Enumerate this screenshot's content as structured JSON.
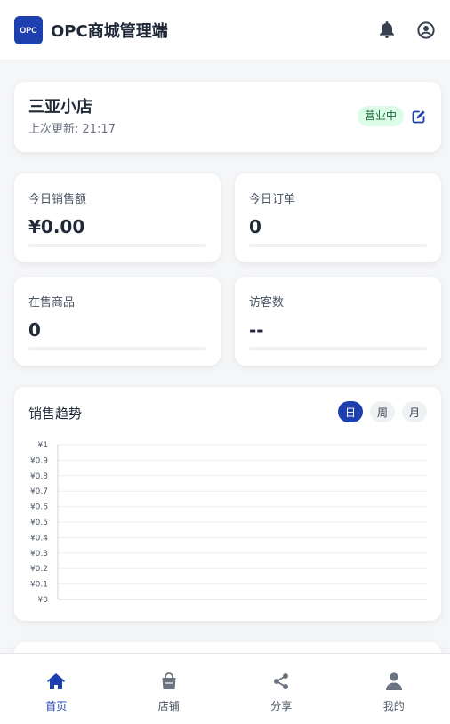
{
  "header": {
    "logo_text": "OPC",
    "title": "OPC商城管理端",
    "icons": [
      "bell-icon",
      "user-circle-icon"
    ]
  },
  "store": {
    "name": "三亚小店",
    "updated": "上次更新: 21:17",
    "status": "营业中",
    "status_color": "#dcfce7"
  },
  "stats": [
    {
      "label": "今日销售额",
      "value": "¥0.00"
    },
    {
      "label": "今日订单",
      "value": "0"
    },
    {
      "label": "在售商品",
      "value": "0"
    },
    {
      "label": "访客数",
      "value": "--"
    }
  ],
  "sales_chart": {
    "title": "销售趋势",
    "tabs": [
      {
        "label": "日",
        "active": true
      },
      {
        "label": "周",
        "active": false
      },
      {
        "label": "月",
        "active": false
      }
    ]
  },
  "chart_data": {
    "type": "line",
    "title": "销售趋势",
    "x": [],
    "series": [],
    "y_ticks": [
      "¥0",
      "¥0.1",
      "¥0.2",
      "¥0.3",
      "¥0.4",
      "¥0.5",
      "¥0.6",
      "¥0.7",
      "¥0.8",
      "¥0.9",
      "¥1"
    ],
    "ylim": [
      0,
      1
    ],
    "grid": true
  },
  "bottom_nav": [
    {
      "label": "首页",
      "icon": "home-icon",
      "active": true
    },
    {
      "label": "店铺",
      "icon": "shopping-bag-icon",
      "active": false
    },
    {
      "label": "分享",
      "icon": "share-icon",
      "active": false
    },
    {
      "label": "我的",
      "icon": "user-icon",
      "active": false
    }
  ],
  "colors": {
    "primary": "#1e40af",
    "background": "#f5f6f8"
  }
}
